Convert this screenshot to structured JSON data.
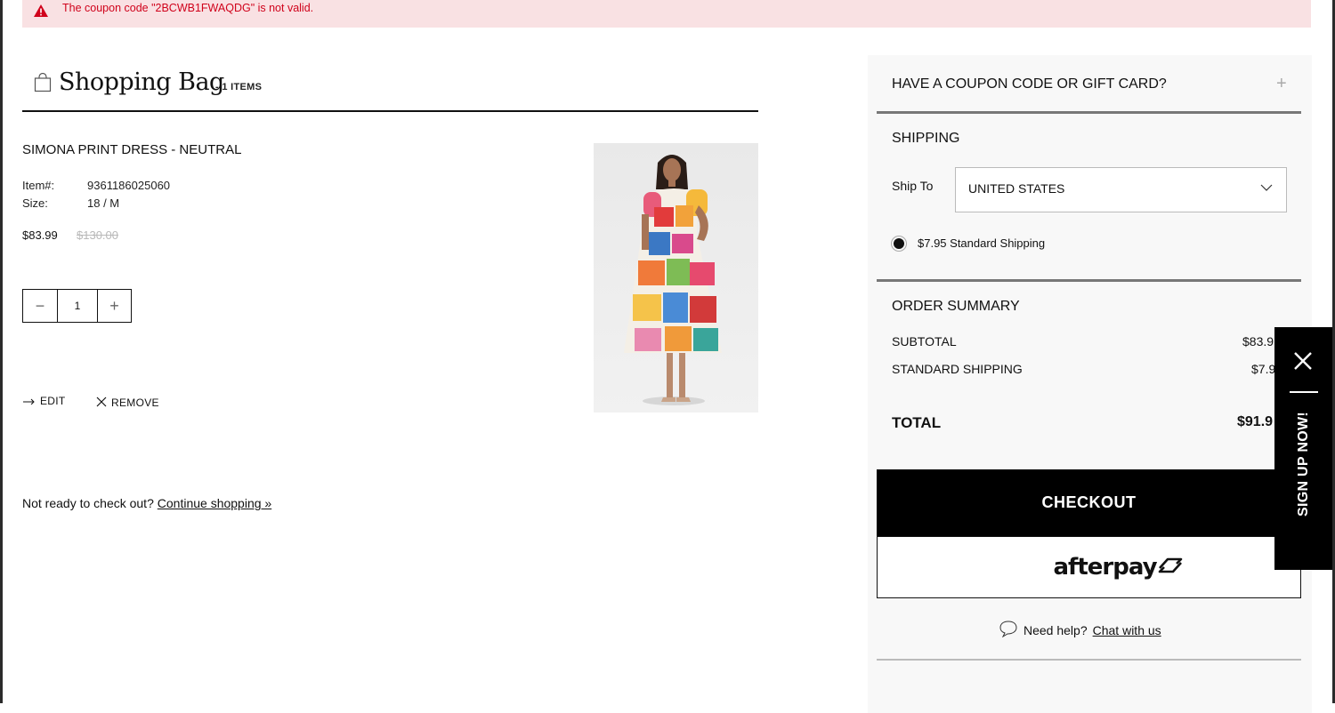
{
  "alert": {
    "message": "The coupon code \"2BCWB1FWAQDG\" is not valid.",
    "icon": "warning-triangle-icon",
    "color": "#d0021b"
  },
  "bag": {
    "title": "Shopping Bag",
    "count_label": "- 1 ITEMS"
  },
  "item": {
    "name": "SIMONA PRINT DRESS - NEUTRAL",
    "item_label": "Item#:",
    "item_value": "9361186025060",
    "size_label": "Size:",
    "size_value": "18 / M",
    "price": "$83.99",
    "original_price": "$130.00",
    "quantity": "1",
    "qty_minus": "−",
    "qty_plus": "+",
    "edit_label": "EDIT",
    "remove_label": "REMOVE"
  },
  "continue": {
    "prompt": "Not ready to check out?",
    "link": "Continue shopping »"
  },
  "coupon": {
    "label": "HAVE A COUPON CODE OR GIFT CARD?",
    "expand": "+"
  },
  "shipping": {
    "title": "SHIPPING",
    "ship_to_label": "Ship To",
    "country": "UNITED STATES",
    "option": "$7.95 Standard Shipping"
  },
  "summary": {
    "title": "ORDER SUMMARY",
    "subtotal_label": "SUBTOTAL",
    "subtotal_value": "$83.9",
    "shipping_label": "STANDARD SHIPPING",
    "shipping_value": "$7.9",
    "total_label": "TOTAL",
    "total_value": "$91.9"
  },
  "checkout": {
    "label": "CHECKOUT",
    "afterpay": "afterpay"
  },
  "help": {
    "prompt": "Need help?",
    "link": "Chat with us"
  },
  "signup": {
    "label": "SIGN UP NOW!"
  }
}
